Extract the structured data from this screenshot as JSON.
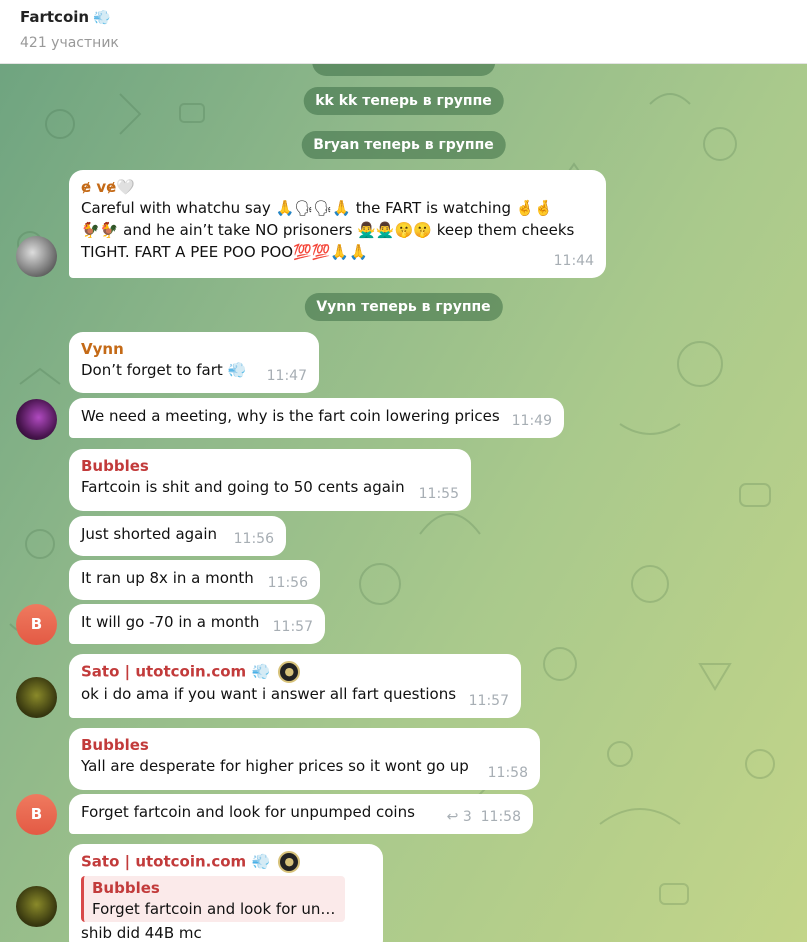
{
  "header": {
    "title": "Fartcoin",
    "title_icon": "💨",
    "subtitle": "421 участник"
  },
  "service_messages": [
    "kk kk теперь в группе",
    "Bryan теперь в группе",
    "Vynn теперь в группе"
  ],
  "colors": {
    "vynn": "#c46a17",
    "bubbles": "#c23b3b",
    "sato": "#c23b3b",
    "eve": "#c46a17"
  },
  "messages": {
    "eve": {
      "sender": "ɇ vɇ🤍",
      "text": "Careful with whatchu say 🙏🗣🗣🙏 the FART is watching 🤞🤞 🐓🐓 and he ain’t take NO prisoners 🙅‍♂️🙅‍♂️🤫🤫 keep them cheeks TIGHT. FART A PEE POO POO💯💯🙏🙏",
      "time": "11:44"
    },
    "vynn1": {
      "sender": "Vynn",
      "text": "Don’t forget to fart 💨",
      "time": "11:47"
    },
    "vynn2": {
      "text": "We need a meeting, why is the fart coin lowering prices",
      "time": "11:49"
    },
    "b1": {
      "sender": "Bubbles",
      "text": "Fartcoin is shit and going to 50 cents again",
      "time": "11:55"
    },
    "b2": {
      "text": "Just shorted again",
      "time": "11:56"
    },
    "b3": {
      "text": "It ran up 8x in a month",
      "time": "11:56"
    },
    "b4": {
      "text": "It will go -70 in a month",
      "time": "11:57"
    },
    "b_avatar": "B",
    "sato1": {
      "sender": "Sato | utotcoin.com",
      "sender_icon": "💨",
      "text": "ok i do ama if you want i answer all fart questions",
      "time": "11:57"
    },
    "b5": {
      "sender": "Bubbles",
      "text": "Yall are desperate for higher prices so it wont go up",
      "time": "11:58"
    },
    "b6": {
      "text": "Forget fartcoin and look for unpumped coins",
      "time": "11:58",
      "reply_icon": "↩",
      "reply_count": "3"
    },
    "sato2": {
      "sender": "Sato | utotcoin.com",
      "sender_icon": "💨",
      "quote_sender": "Bubbles",
      "quote_text": "Forget fartcoin and look for unpu...",
      "text": "shib did 44B mc"
    }
  }
}
